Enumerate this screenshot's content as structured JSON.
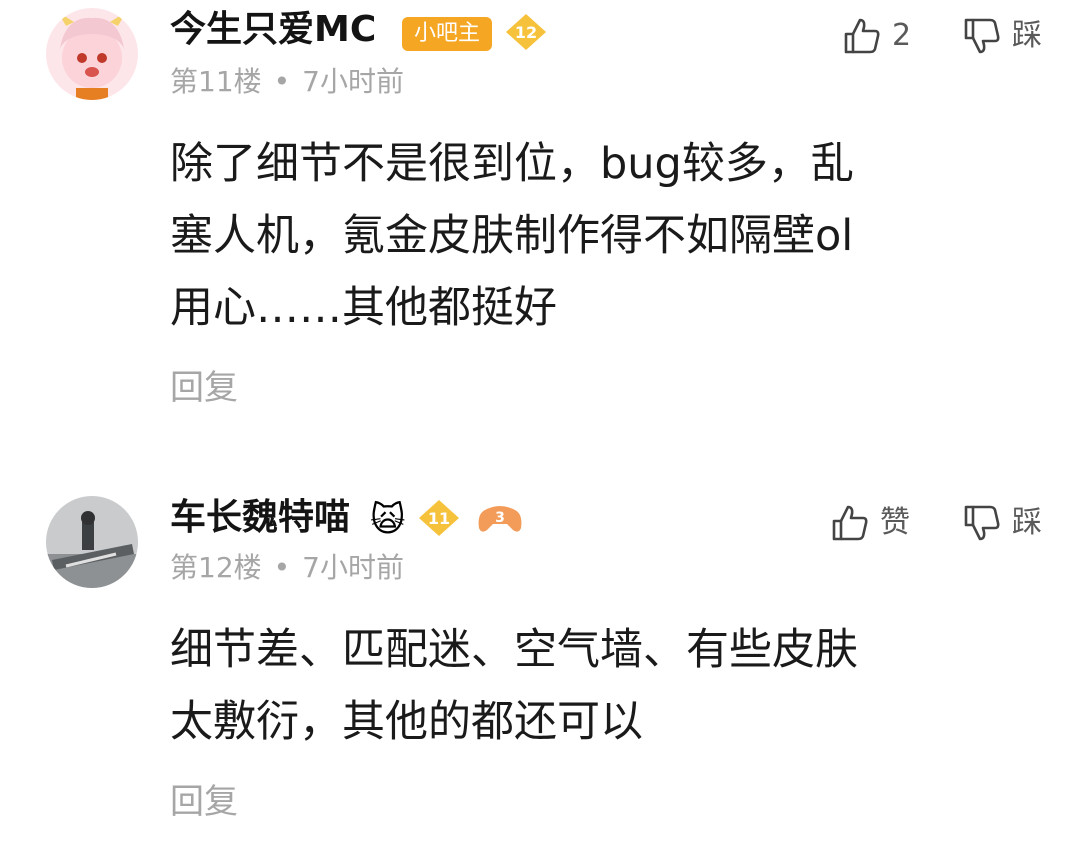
{
  "comments": [
    {
      "username": "今生只爱MC",
      "role_badge": "小吧主",
      "level": "12",
      "floor": "第11楼",
      "separator": "•",
      "time": "7小时前",
      "content_lines": [
        "除了细节不是很到位，bug较多，乱",
        "塞人机，氪金皮肤制作得不如隔壁ol",
        "用心……其他都挺好"
      ],
      "reply_label": "回复",
      "like_label": "2",
      "dislike_label": "踩",
      "avatar_icon": "anime-girl-avatar"
    },
    {
      "username": "车长魏特喵",
      "emoji": "🙀",
      "level": "11",
      "extra_badge": "3",
      "floor": "第12楼",
      "separator": "•",
      "time": "7小时前",
      "content_lines": [
        "细节差、匹配迷、空气墙、有些皮肤",
        "太敷衍，其他的都还可以"
      ],
      "reply_label": "回复",
      "like_label": "赞",
      "dislike_label": "踩",
      "avatar_icon": "tank-photo-avatar"
    }
  ],
  "colors": {
    "badge_orange": "#f5a623",
    "level_gold": "#f7c23b",
    "meta_gray": "#a6a6a6"
  }
}
